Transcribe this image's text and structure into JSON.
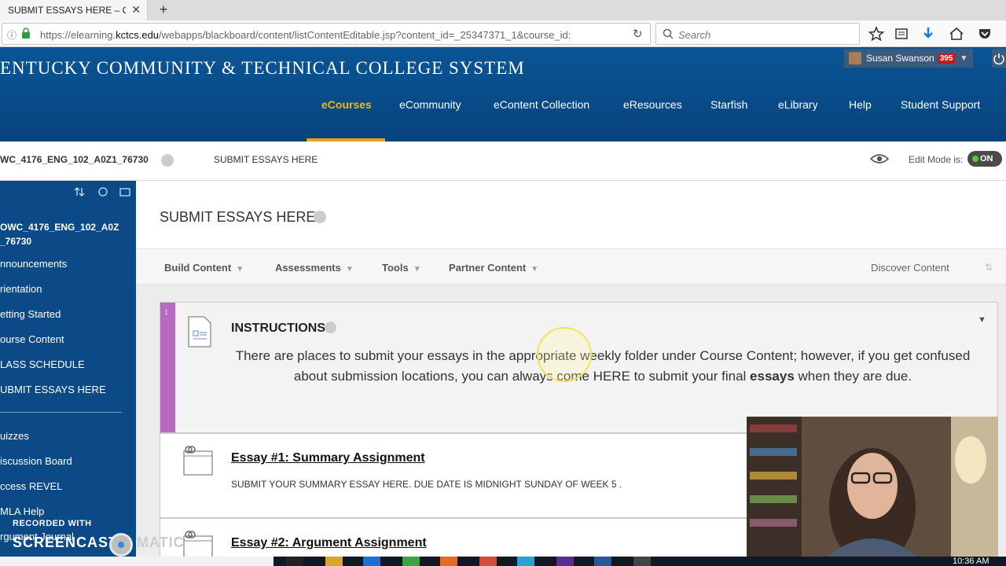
{
  "browser": {
    "tab_title": "SUBMIT ESSAYS HERE – O...",
    "tab_close": "✕",
    "new_tab": "+",
    "url_prefix": "https://elearning.",
    "url_domain": "kctcs.edu",
    "url_rest": "/webapps/blackboard/content/listContentEditable.jsp?content_id=_25347371_1&course_id:",
    "search_placeholder": "Search"
  },
  "header": {
    "college_name": "ENTUCKY COMMUNITY & TECHNICAL COLLEGE SYSTEM",
    "user_name": "Susan Swanson",
    "notification_count": "395",
    "nav": [
      {
        "label": "eCourses",
        "active": true
      },
      {
        "label": "eCommunity"
      },
      {
        "label": "eContent Collection"
      },
      {
        "label": "eResources"
      },
      {
        "label": "Starfish"
      },
      {
        "label": "eLibrary"
      },
      {
        "label": "Help"
      },
      {
        "label": "Student Support"
      }
    ]
  },
  "breadcrumb": {
    "course": "WC_4176_ENG_102_A0Z1_76730",
    "current": "SUBMIT ESSAYS HERE",
    "edit_mode_label": "Edit Mode is:",
    "edit_mode_value": "ON"
  },
  "sidebar": {
    "course_title": "OWC_4176_ENG_102_A0Z _76730",
    "items": [
      "nnouncements",
      "rientation",
      "etting Started",
      "ourse Content",
      "LASS SCHEDULE",
      "UBMIT ESSAYS HERE"
    ],
    "items2": [
      "uizzes",
      "iscussion Board",
      "ccess REVEL",
      "MLA Help",
      "rgument Journal"
    ]
  },
  "content": {
    "page_title": "SUBMIT ESSAYS HERE",
    "actions": [
      "Build Content",
      "Assessments",
      "Tools",
      "Partner Content"
    ],
    "discover": "Discover Content",
    "instructions_title": "INSTRUCTIONS",
    "instructions_text_1": "There are places to submit your essays in the appropriate weekly folder under Course Content; however, if you get confused about submission locations, you can always come HERE to submit your final ",
    "instructions_bold": "essays",
    "instructions_text_2": " when they are due.",
    "essay1_title": "Essay #1: Summary Assignment",
    "essay1_desc": "SUBMIT YOUR SUMMARY ESSAY HERE. DUE DATE IS MIDNIGHT SUNDAY OF WEEK 5 .",
    "essay2_title": "Essay #2: Argument Assignment"
  },
  "watermark": {
    "recorded_with": "RECORDED WITH",
    "screencast": "SCREENCAST",
    "matic": "MATIC"
  },
  "taskbar": {
    "time": "10:36 AM"
  },
  "colors": {
    "header_blue": "#0b5596",
    "active_nav": "#f5b900",
    "instructions_stripe": "#b66ac0",
    "edit_on": "#5ac63b"
  }
}
